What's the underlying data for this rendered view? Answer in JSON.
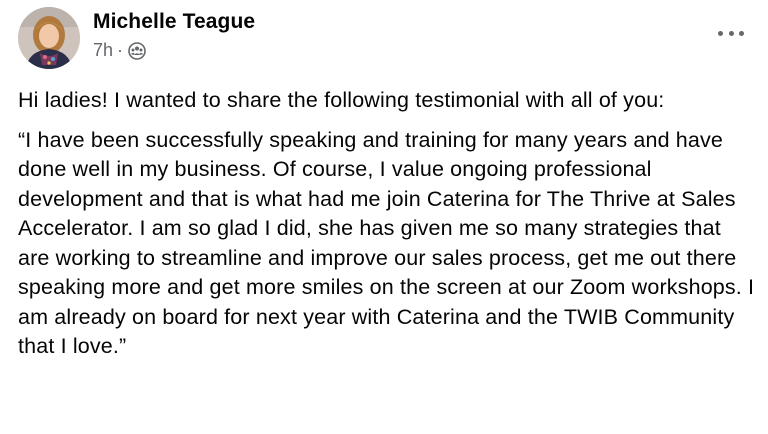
{
  "post": {
    "author": {
      "name": "Michelle Teague",
      "avatar_icon": "profile-photo"
    },
    "timestamp": "7h",
    "separator": "·",
    "audience_icon": "group-members-icon",
    "more_icon": "more-options-icon",
    "paragraphs": [
      "Hi ladies!  I wanted to share the following testimonial with all of you:",
      "“I have been successfully speaking and training for many years and have done well in my business. Of course, I value ongoing professional development and that is what had me join Caterina for The Thrive at Sales Accelerator. I am so glad I did, she has given me so many strategies that are working to streamline and improve our sales process, get me out there speaking more and get more smiles on the screen at our Zoom workshops. I am already on board for next year with Caterina and the TWIB Community that I love.”"
    ]
  },
  "colors": {
    "text": "#050505",
    "secondary": "#65676b",
    "background": "#ffffff"
  }
}
